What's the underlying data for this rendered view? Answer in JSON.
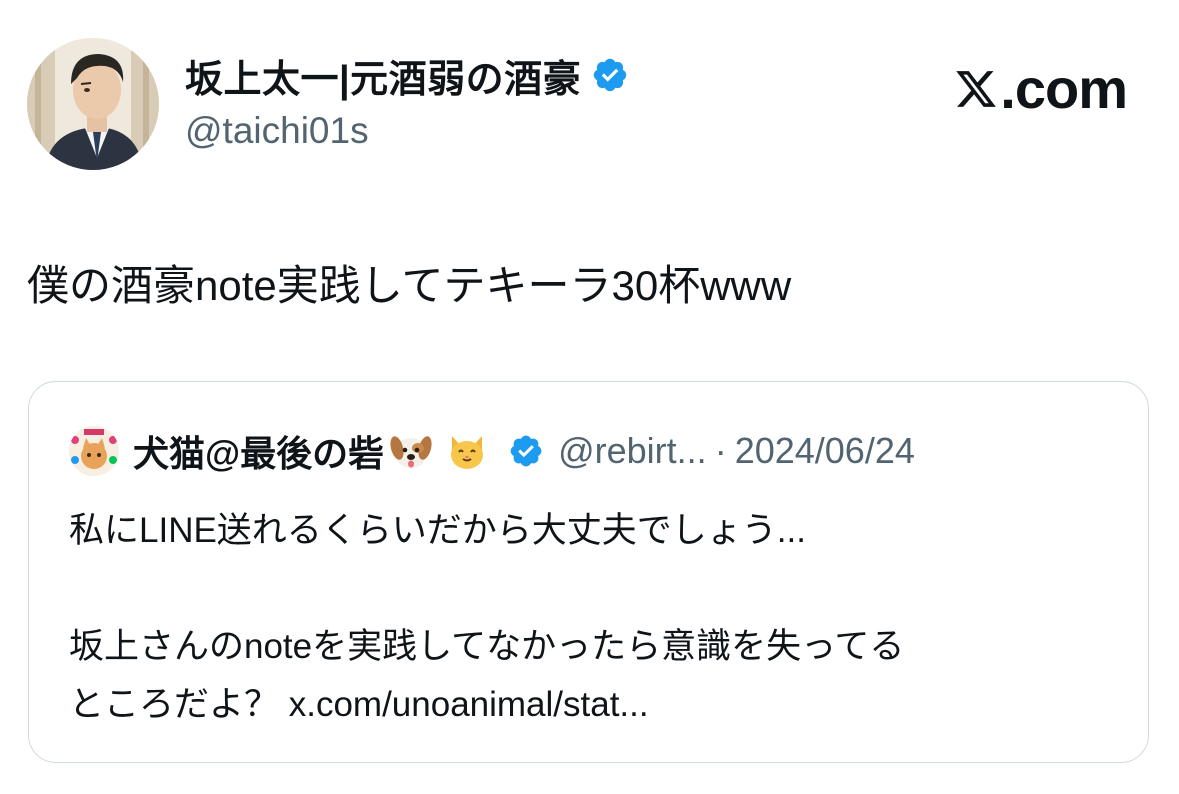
{
  "author": {
    "display_name": "坂上太一|元酒弱の酒豪",
    "handle": "@taichi01s",
    "verified": true
  },
  "brand": {
    "label": ".com",
    "icon": "x-logo-icon"
  },
  "tweet": {
    "text": "僕の酒豪note実践してテキーラ30杯www"
  },
  "quoted": {
    "display_name": "犬猫@最後の砦",
    "emojis": [
      "dog-face-icon",
      "cat-face-icon"
    ],
    "verified": true,
    "handle": "@rebirt...",
    "separator": "·",
    "date": "2024/06/24",
    "lines": [
      "私にLINE送れるくらいだから大丈夫でしょう...",
      "",
      "坂上さんのnoteを実践してなかったら意識を失ってる",
      "ところだよ？ x.com/unoanimal/stat..."
    ]
  },
  "colors": {
    "text": "#0f1419",
    "muted": "#536471",
    "verified_blue": "#1d9bf0",
    "card_border": "#cfd9de"
  }
}
